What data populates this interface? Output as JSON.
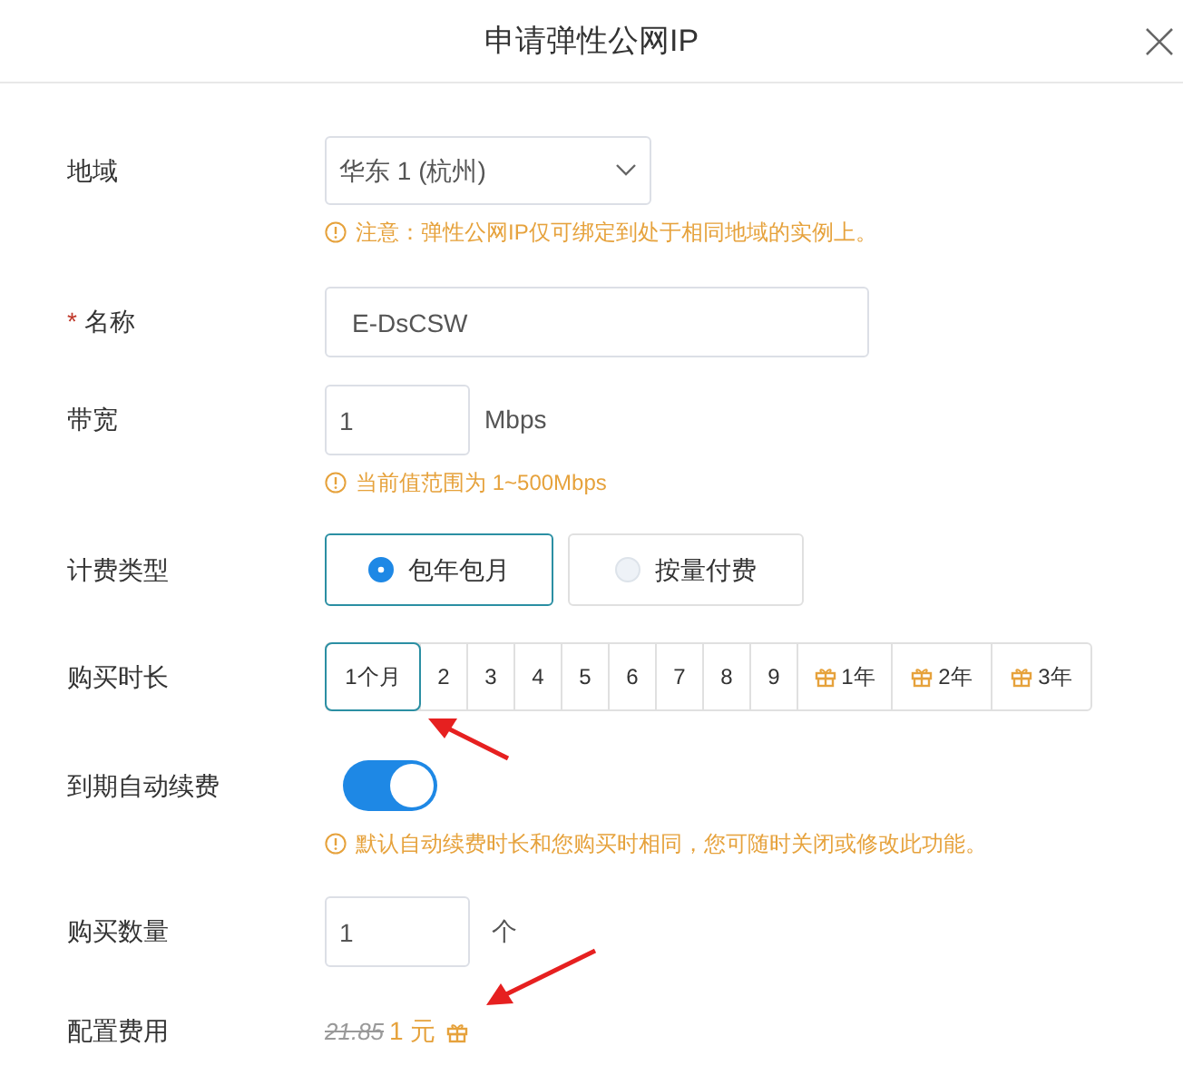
{
  "dialog": {
    "title": "申请弹性公网IP"
  },
  "region": {
    "label": "地域",
    "value": "华东 1 (杭州)",
    "hint": "注意：弹性公网IP仅可绑定到处于相同地域的实例上。"
  },
  "name": {
    "label": "名称",
    "required_mark": "*",
    "value": "E-DsCSW"
  },
  "bandwidth": {
    "label": "带宽",
    "value": "1",
    "unit": "Mbps",
    "hint": "当前值范围为 1~500Mbps"
  },
  "billing": {
    "label": "计费类型",
    "options": [
      {
        "label": "包年包月",
        "selected": true
      },
      {
        "label": "按量付费",
        "selected": false
      }
    ]
  },
  "duration": {
    "label": "购买时长",
    "options": [
      {
        "label": "1个月",
        "selected": true,
        "gift": false
      },
      {
        "label": "2",
        "selected": false,
        "gift": false
      },
      {
        "label": "3",
        "selected": false,
        "gift": false
      },
      {
        "label": "4",
        "selected": false,
        "gift": false
      },
      {
        "label": "5",
        "selected": false,
        "gift": false
      },
      {
        "label": "6",
        "selected": false,
        "gift": false
      },
      {
        "label": "7",
        "selected": false,
        "gift": false
      },
      {
        "label": "8",
        "selected": false,
        "gift": false
      },
      {
        "label": "9",
        "selected": false,
        "gift": false
      },
      {
        "label": "1年",
        "selected": false,
        "gift": true
      },
      {
        "label": "2年",
        "selected": false,
        "gift": true
      },
      {
        "label": "3年",
        "selected": false,
        "gift": true
      }
    ]
  },
  "auto_renew": {
    "label": "到期自动续费",
    "on": true,
    "hint": "默认自动续费时长和您购买时相同，您可随时关闭或修改此功能。"
  },
  "quantity": {
    "label": "购买数量",
    "value": "1",
    "unit": "个"
  },
  "fee": {
    "label": "配置费用",
    "original": "21.85",
    "price": "1 元"
  }
}
